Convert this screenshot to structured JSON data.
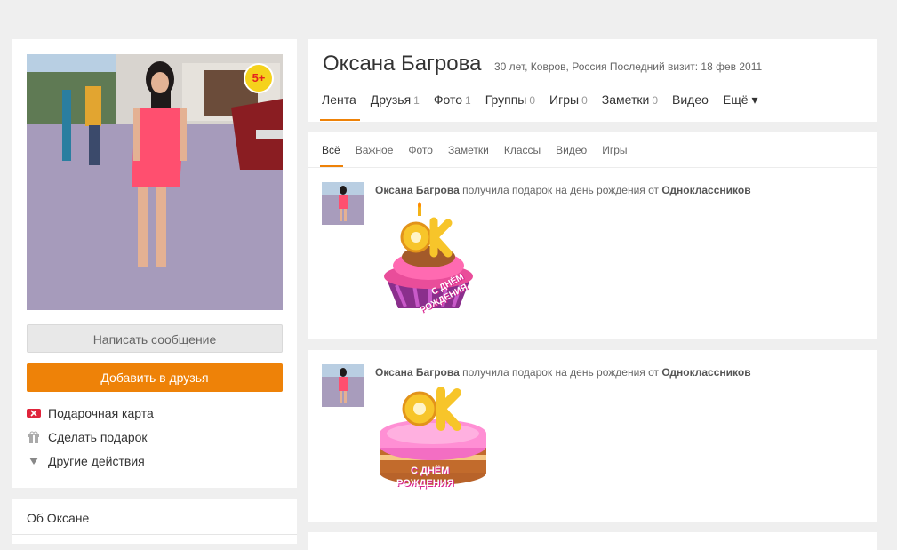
{
  "profile": {
    "name": "Оксана Багрова",
    "meta": "30 лет, Ковров, Россия  Последний визит: 18 фев 2011",
    "age_badge": "5+"
  },
  "left": {
    "message_button": "Написать сообщение",
    "add_friend_button": "Добавить в друзья",
    "actions": [
      "Подарочная карта",
      "Сделать подарок",
      "Другие действия"
    ],
    "about": "Об Оксане"
  },
  "nav": [
    {
      "label": "Лента",
      "count": ""
    },
    {
      "label": "Друзья",
      "count": "1"
    },
    {
      "label": "Фото",
      "count": "1"
    },
    {
      "label": "Группы",
      "count": "0"
    },
    {
      "label": "Игры",
      "count": "0"
    },
    {
      "label": "Заметки",
      "count": "0"
    },
    {
      "label": "Видео",
      "count": ""
    },
    {
      "label": "Ещё ▾",
      "count": ""
    }
  ],
  "feed_tabs": [
    "Всё",
    "Важное",
    "Фото",
    "Заметки",
    "Классы",
    "Видео",
    "Игры"
  ],
  "posts": [
    {
      "author": "Оксана Багрова",
      "text": "получила подарок на день рождения от",
      "from": "Одноклассников",
      "gift_logo": "OK",
      "gift_caption_1": "С ДНЁМ",
      "gift_caption_2": "РОЖДЕНИЯ"
    },
    {
      "author": "Оксана Багрова",
      "text": "получила подарок на день рождения от",
      "from": "Одноклассников",
      "gift_logo": "OK",
      "gift_caption_1": "С ДНЁМ",
      "gift_caption_2": "РОЖДЕНИЯ"
    }
  ],
  "colors": {
    "accent": "#ee8208",
    "background": "#efefef"
  },
  "icons": [
    "gift-card-icon",
    "gift-icon",
    "triangle-down-icon"
  ]
}
